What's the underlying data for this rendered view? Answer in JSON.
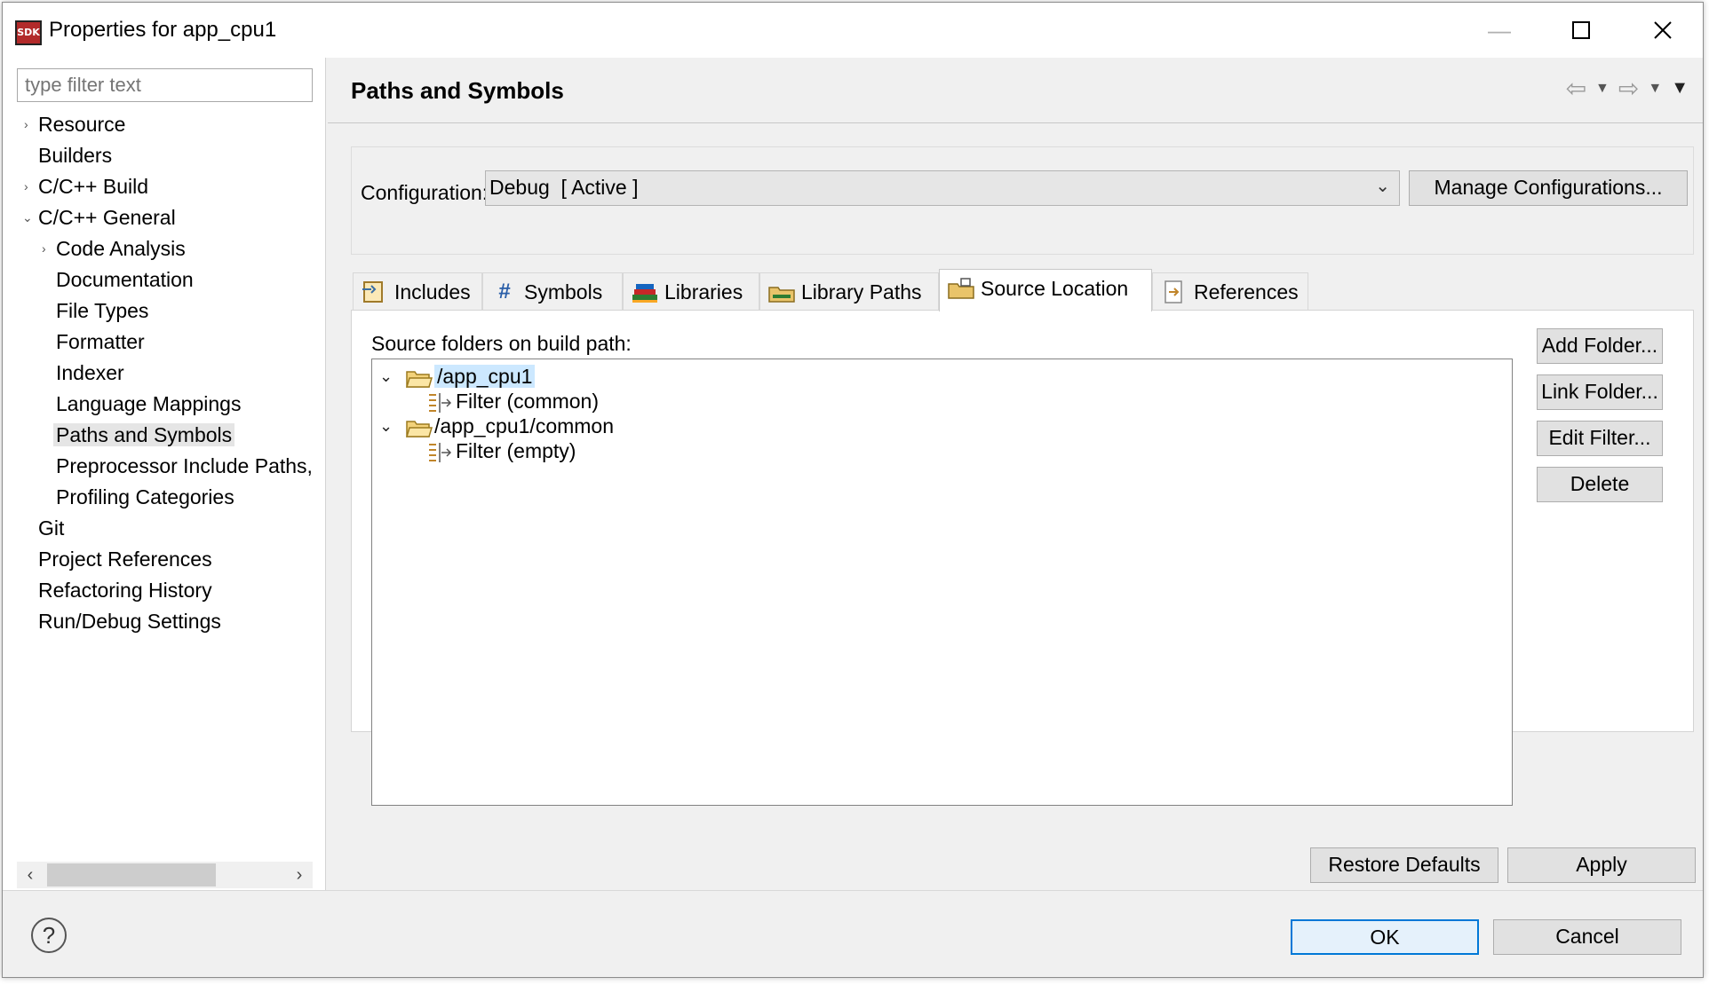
{
  "window": {
    "title": "Properties for app_cpu1",
    "app_icon_text": "SDK"
  },
  "filter": {
    "placeholder": "type filter text"
  },
  "tree": [
    {
      "label": "Resource",
      "expandable": true
    },
    {
      "label": "Builders"
    },
    {
      "label": "C/C++ Build",
      "expandable": true
    },
    {
      "label": "C/C++ General",
      "expanded": true
    },
    {
      "label": "Code Analysis",
      "expandable": true
    },
    {
      "label": "Documentation"
    },
    {
      "label": "File Types"
    },
    {
      "label": "Formatter"
    },
    {
      "label": "Indexer"
    },
    {
      "label": "Language Mappings"
    },
    {
      "label": "Paths and Symbols",
      "selected": true
    },
    {
      "label": "Preprocessor Include Paths,"
    },
    {
      "label": "Profiling Categories"
    },
    {
      "label": "Git"
    },
    {
      "label": "Project References"
    },
    {
      "label": "Refactoring History"
    },
    {
      "label": "Run/Debug Settings"
    }
  ],
  "page": {
    "title": "Paths and Symbols"
  },
  "config": {
    "label": "Configuration:",
    "value": "Debug  [ Active ]",
    "manage_button": "Manage Configurations..."
  },
  "tabs": [
    {
      "label": "Includes",
      "icon": "includes-icon"
    },
    {
      "label": "Symbols",
      "icon": "hash-icon"
    },
    {
      "label": "Libraries",
      "icon": "libraries-icon"
    },
    {
      "label": "Library Paths",
      "icon": "library-paths-icon"
    },
    {
      "label": "Source Location",
      "icon": "source-location-icon",
      "active": true
    },
    {
      "label": "References",
      "icon": "references-icon"
    }
  ],
  "source": {
    "label": "Source folders on build path:",
    "items": [
      {
        "label": "/app_cpu1",
        "type": "folder",
        "selected": true
      },
      {
        "label": "Filter (common)",
        "type": "filter"
      },
      {
        "label": "/app_cpu1/common",
        "type": "folder"
      },
      {
        "label": "Filter (empty)",
        "type": "filter"
      }
    ],
    "buttons": {
      "add": "Add Folder...",
      "link": "Link Folder...",
      "edit": "Edit Filter...",
      "delete": "Delete"
    }
  },
  "actions": {
    "restore": "Restore Defaults",
    "apply": "Apply",
    "ok": "OK",
    "cancel": "Cancel"
  }
}
